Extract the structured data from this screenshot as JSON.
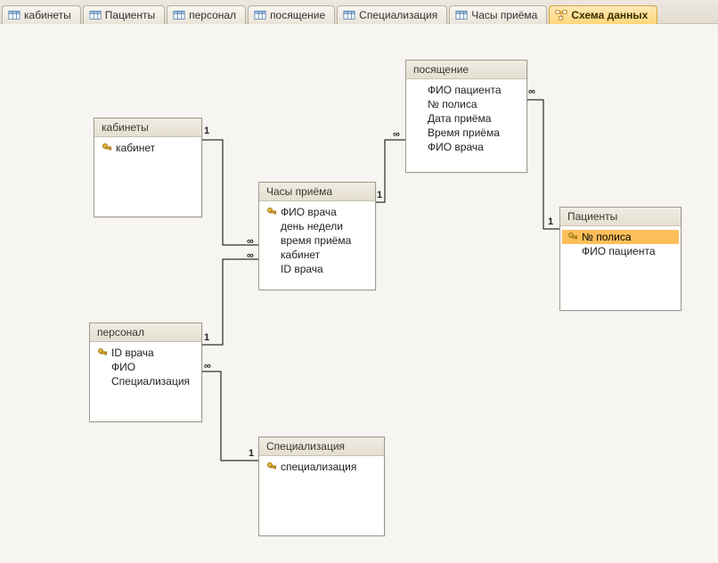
{
  "tabs": [
    {
      "label": "кабинеты",
      "type": "table",
      "active": false
    },
    {
      "label": "Пациенты",
      "type": "table",
      "active": false
    },
    {
      "label": "персонал",
      "type": "table",
      "active": false
    },
    {
      "label": "посящение",
      "type": "table",
      "active": false
    },
    {
      "label": "Специализация",
      "type": "table",
      "active": false
    },
    {
      "label": "Часы приёма",
      "type": "table",
      "active": false
    },
    {
      "label": "Схема данных",
      "type": "relationships",
      "active": true
    }
  ],
  "tables": {
    "kabinety": {
      "title": "кабинеты",
      "fields": [
        {
          "name": "кабинет",
          "pk": true
        }
      ]
    },
    "chasy": {
      "title": "Часы приёма",
      "fields": [
        {
          "name": "ФИО врача",
          "pk": true
        },
        {
          "name": "день недели",
          "pk": false
        },
        {
          "name": "время приёма",
          "pk": false
        },
        {
          "name": "кабинет",
          "pk": false
        },
        {
          "name": "ID врача",
          "pk": false
        }
      ]
    },
    "posyashenie": {
      "title": "посящение",
      "fields": [
        {
          "name": "ФИО пациента",
          "pk": false
        },
        {
          "name": "№ полиса",
          "pk": false
        },
        {
          "name": "Дата приёма",
          "pk": false
        },
        {
          "name": "Время приёма",
          "pk": false
        },
        {
          "name": "ФИО врача",
          "pk": false
        }
      ]
    },
    "personal": {
      "title": "персонал",
      "fields": [
        {
          "name": "ID врача",
          "pk": true
        },
        {
          "name": "ФИО",
          "pk": false
        },
        {
          "name": "Специализация",
          "pk": false
        }
      ]
    },
    "specializaciya": {
      "title": "Специализация",
      "fields": [
        {
          "name": "специализация",
          "pk": true
        }
      ]
    },
    "pacienty": {
      "title": "Пациенты",
      "fields": [
        {
          "name": "№ полиса",
          "pk": true,
          "selected": true
        },
        {
          "name": "ФИО пациента",
          "pk": false
        }
      ]
    }
  },
  "rel_labels": {
    "one": "1",
    "many": "∞"
  }
}
